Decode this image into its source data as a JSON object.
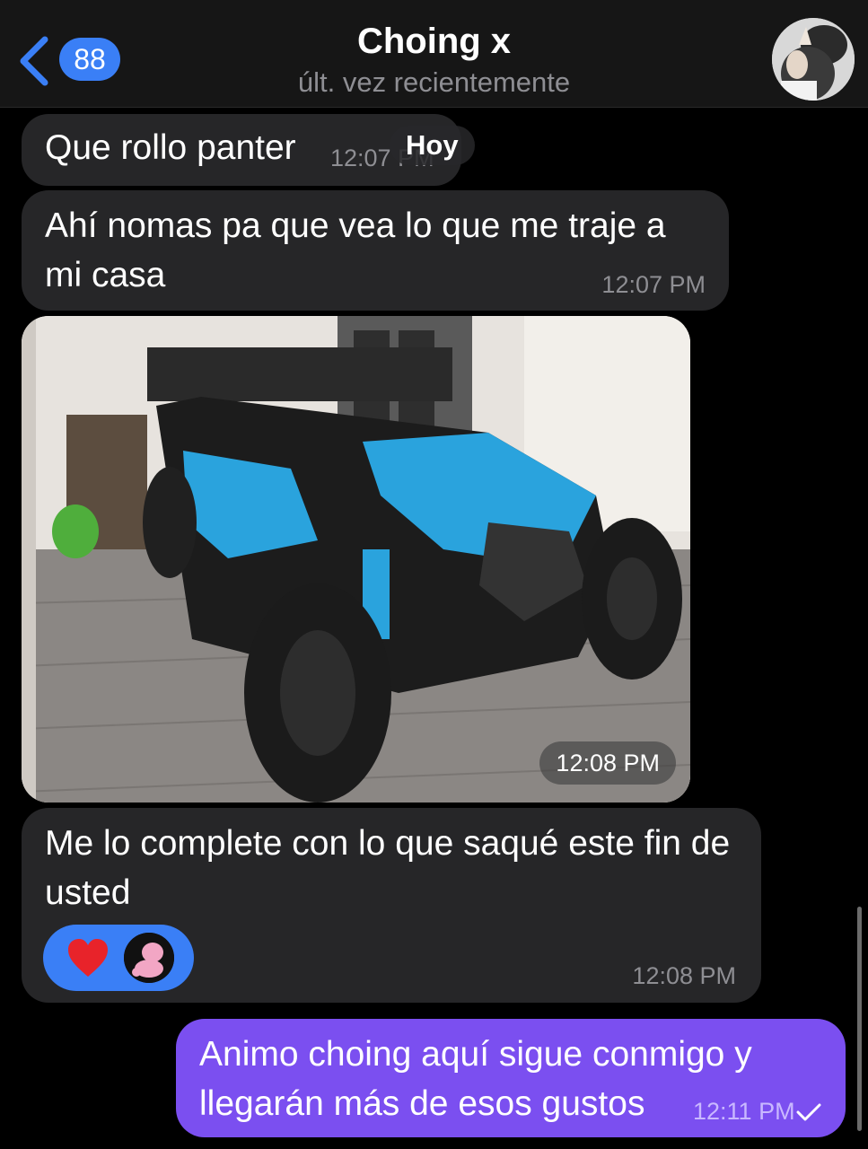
{
  "header": {
    "back_badge": "88",
    "title": "Choing x",
    "status": "últ. vez recientemente"
  },
  "date_pill": "Hoy",
  "messages": [
    {
      "text": "Que rollo panter",
      "time": "12:07 PM"
    },
    {
      "text": "Ahí nomas pa que vea lo que me traje a mi casa",
      "time": "12:07 PM"
    },
    {
      "time": "12:08 PM"
    },
    {
      "text": "Me lo complete con lo que saqué este fin de usted",
      "time": "12:08 PM"
    },
    {
      "text": "Animo choing aquí sigue conmigo y llegarán más de esos gustos",
      "time": "12:11 PM"
    }
  ],
  "colors": {
    "incoming_bubble": "#262628",
    "outgoing_bubble": "#7b4ff0",
    "accent_blue": "#3a7ff6",
    "reaction_heart": "#e8232a"
  }
}
